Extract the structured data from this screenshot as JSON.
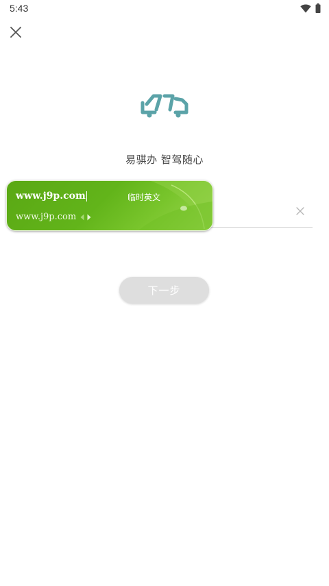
{
  "status_bar": {
    "time": "5:43",
    "icons": [
      "wifi-icon",
      "battery-icon"
    ]
  },
  "header": {
    "close_icon": "close-icon"
  },
  "brand": {
    "logo_icon": "truck-logo-icon",
    "slogan": "易骐办 智驾随心",
    "logo_color": "#5ba3a8"
  },
  "form": {
    "input_value": "",
    "clear_icon": "clear-icon",
    "next_label": "下一步",
    "next_button_color": "#dedede"
  },
  "ime": {
    "composition": "www.j9p.com",
    "mode_label": "临时英文",
    "candidate": "www.j9p.com",
    "accent_color": "#62b41a"
  }
}
